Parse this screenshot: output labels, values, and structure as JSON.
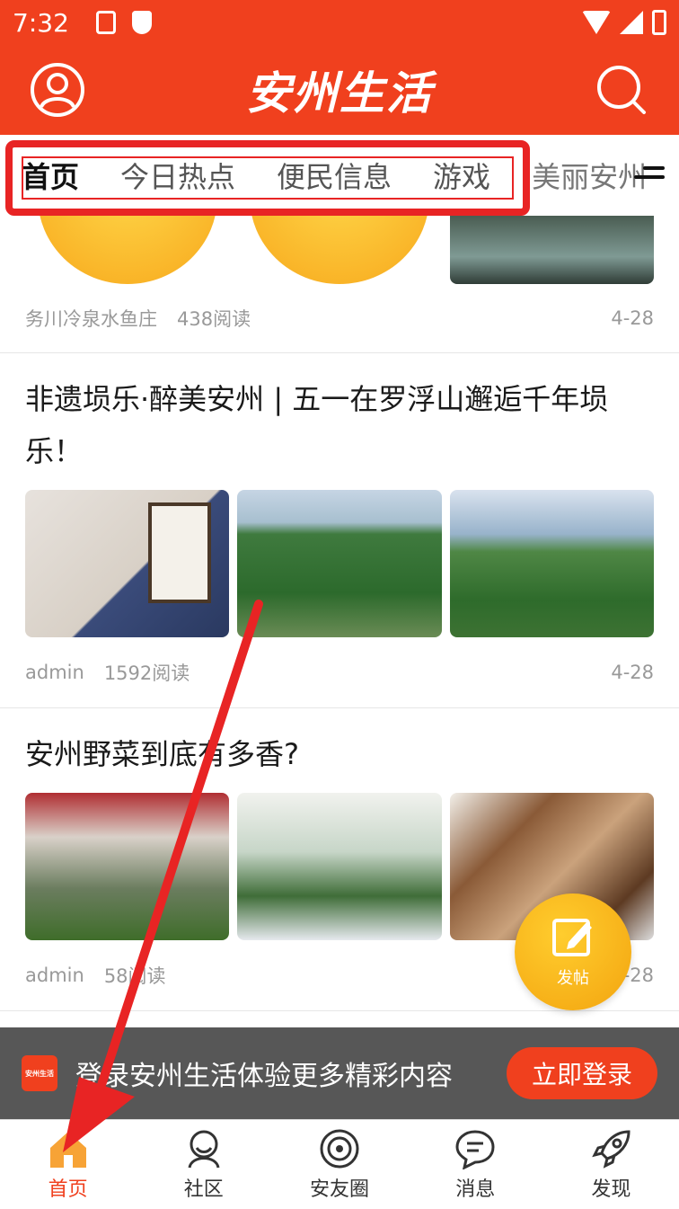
{
  "status_bar": {
    "time": "7:32"
  },
  "header": {
    "brand": "安州生活",
    "colors": {
      "primary": "#f0401e"
    }
  },
  "tabs": [
    {
      "label": "首页",
      "active": true
    },
    {
      "label": "今日热点"
    },
    {
      "label": "便民信息"
    },
    {
      "label": "游戏"
    },
    {
      "label": "美丽安州"
    }
  ],
  "feed": [
    {
      "title": "",
      "author": "务川冷泉水鱼庄",
      "reads": "438阅读",
      "date": "4-28"
    },
    {
      "title": "非遗埙乐·醉美安州 | 五一在罗浮山邂逅千年埙乐！",
      "author": "admin",
      "reads": "1592阅读",
      "date": "4-28"
    },
    {
      "title": "安州野菜到底有多香?",
      "author": "admin",
      "reads": "58阅读",
      "date": "4-28"
    }
  ],
  "fab": {
    "label": "发帖"
  },
  "login_banner": {
    "logo_text": "安州生活",
    "text": "登录安州生活体验更多精彩内容",
    "button": "立即登录"
  },
  "bottom_nav": [
    {
      "label": "首页",
      "icon": "home-icon",
      "active": true
    },
    {
      "label": "社区",
      "icon": "community-icon"
    },
    {
      "label": "安友圈",
      "icon": "circle-icon"
    },
    {
      "label": "消息",
      "icon": "message-icon"
    },
    {
      "label": "发现",
      "icon": "rocket-icon"
    }
  ]
}
